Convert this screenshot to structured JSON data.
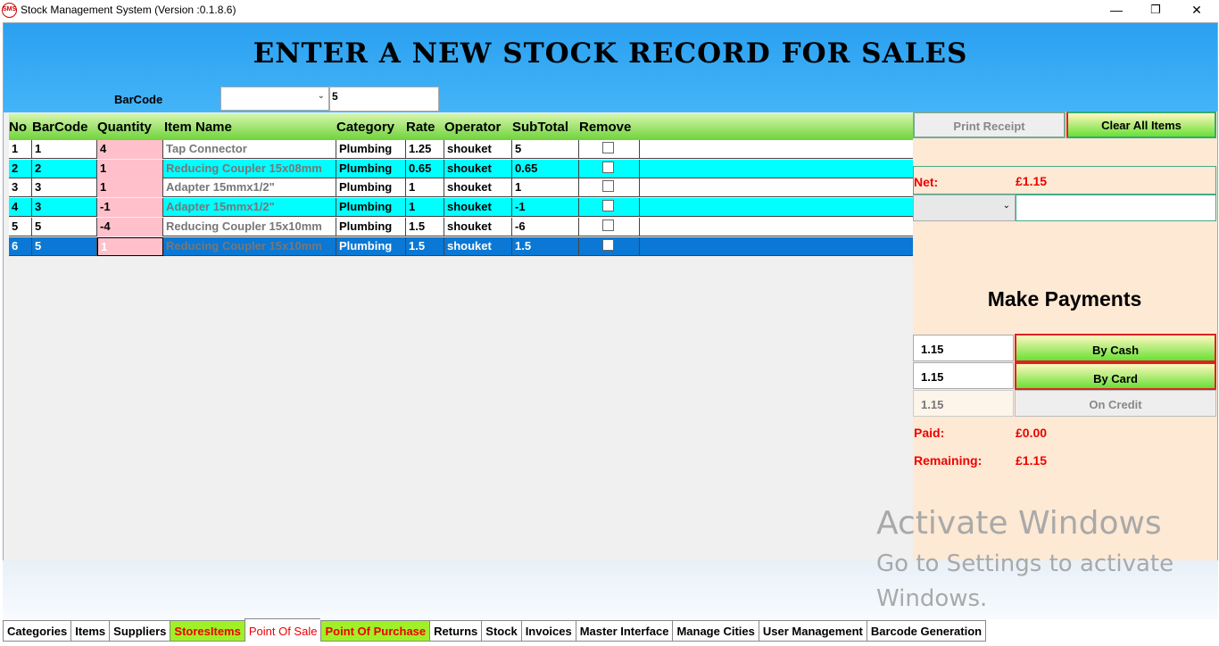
{
  "window": {
    "icon_text": "SMS",
    "title": "Stock Management System (Version :0.1.8.6)",
    "minimize": "—",
    "restore": "❐",
    "close": "✕"
  },
  "header": {
    "title": "ENTER A NEW STOCK RECORD FOR SALES",
    "barcode_label": "BarCode",
    "barcode_select_value": "",
    "barcode_input_value": "5"
  },
  "grid": {
    "columns": [
      "No",
      "BarCode",
      "Quantity",
      "Item Name",
      "Category",
      "Rate",
      "Operator",
      "SubTotal",
      "Remove"
    ],
    "rows": [
      {
        "no": "1",
        "barcode": "1",
        "quantity": "4",
        "item": "Tap Connector",
        "category": "Plumbing",
        "rate": "1.25",
        "operator": "shouket",
        "subtotal": "5"
      },
      {
        "no": "2",
        "barcode": "2",
        "quantity": "1",
        "item": "Reducing Coupler 15x08mm",
        "category": "Plumbing",
        "rate": "0.65",
        "operator": "shouket",
        "subtotal": "0.65"
      },
      {
        "no": "3",
        "barcode": "3",
        "quantity": "1",
        "item": "Adapter 15mmx1/2\"",
        "category": "Plumbing",
        "rate": "1",
        "operator": "shouket",
        "subtotal": "1"
      },
      {
        "no": "4",
        "barcode": "3",
        "quantity": "-1",
        "item": "Adapter 15mmx1/2\"",
        "category": "Plumbing",
        "rate": "1",
        "operator": "shouket",
        "subtotal": "-1"
      },
      {
        "no": "5",
        "barcode": "5",
        "quantity": "-4",
        "item": "Reducing Coupler 15x10mm",
        "category": "Plumbing",
        "rate": "1.5",
        "operator": "shouket",
        "subtotal": "-6"
      },
      {
        "no": "6",
        "barcode": "5",
        "quantity": "1",
        "item": "Reducing Coupler 15x10mm",
        "category": "Plumbing",
        "rate": "1.5",
        "operator": "shouket",
        "subtotal": "1.5"
      }
    ]
  },
  "panel": {
    "print_receipt": "Print Receipt",
    "clear_all": "Clear All Items",
    "net_label": "Net:",
    "net_value": "£1.15",
    "payment_select_value": "",
    "payment_note_value": "",
    "make_payments": "Make Payments",
    "cash_amount": "1.15",
    "by_cash": "By Cash",
    "card_amount": "1.15",
    "by_card": "By Card",
    "credit_amount": "1.15",
    "on_credit": "On Credit",
    "paid_label": "Paid:",
    "paid_value": "£0.00",
    "remaining_label": "Remaining:",
    "remaining_value": "£1.15"
  },
  "watermark": {
    "line1": "Activate Windows",
    "line2": "Go to Settings to activate",
    "line3": "Windows."
  },
  "tabs": [
    "Categories",
    "Items",
    "Suppliers",
    "StoresItems",
    "Point Of Sale",
    "Point Of Purchase",
    "Returns",
    "Stock",
    "Invoices",
    "Master Interface",
    "Manage Cities",
    "User Management",
    "Barcode Generation"
  ],
  "active_tab": "Point Of Sale",
  "colors": {
    "header_blue": "#2aa0f0",
    "row_cyan": "#00ffff",
    "row_selected": "#0a78d4",
    "quantity_pink": "#ffc0cb",
    "panel_peach": "#fde9d4",
    "alert_red": "#e00000",
    "tab_green": "#a0f028"
  }
}
